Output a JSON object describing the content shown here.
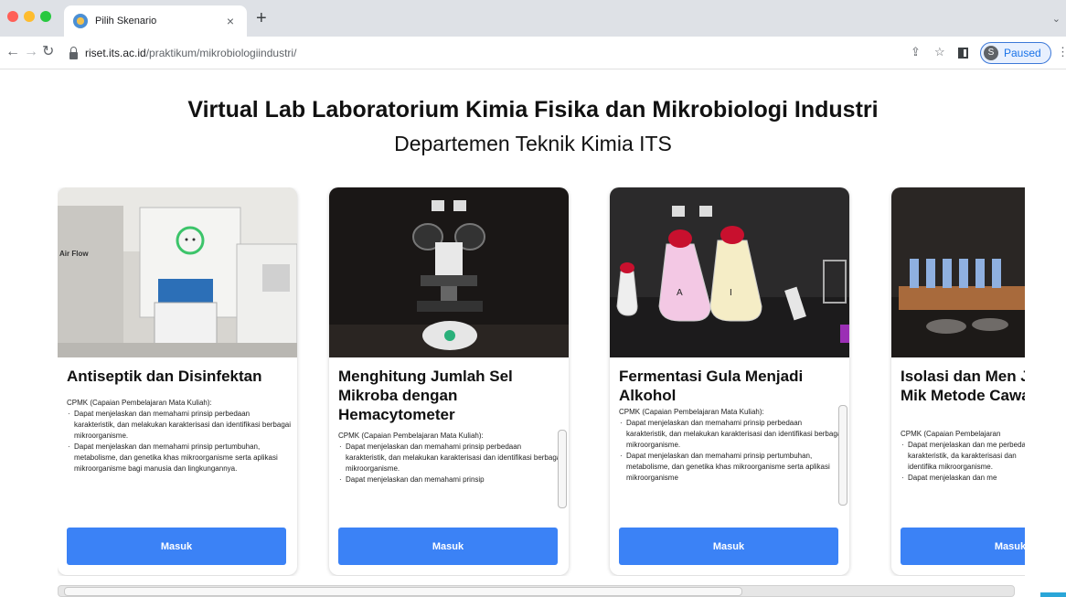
{
  "browser": {
    "tab_title": "Pilih Skenario",
    "tab_close": "×",
    "new_tab": "+",
    "tab_menu": "⌄",
    "url_host": "riset.its.ac.id",
    "url_path": "/praktikum/mikrobiologiindustri/",
    "profile_initial": "S",
    "profile_label": "Paused"
  },
  "page": {
    "heading": "Virtual Lab Laboratorium Kimia Fisika dan Mikrobiologi Industri",
    "subheading": "Departemen Teknik Kimia ITS"
  },
  "cards": [
    {
      "title": "Antiseptik dan Disinfektan",
      "cpmk": "CPMK (Capaian Pembelajaran Mata Kuliah):",
      "points": [
        "Dapat menjelaskan dan memahami prinsip perbedaan karakteristik, dan melakukan karakterisasi dan identifikasi berbagai mikroorganisme.",
        "Dapat menjelaskan dan memahami prinsip pertumbuhan, metabolisme, dan genetika khas mikroorganisme serta aplikasi mikroorganisme bagi manusia dan lingkungannya."
      ],
      "button": "Masuk",
      "image_label": "Air Flow"
    },
    {
      "title": "Menghitung Jumlah Sel Mikroba dengan Hemacytometer",
      "cpmk": "CPMK (Capaian Pembelajaran Mata Kuliah):",
      "points": [
        "Dapat menjelaskan dan memahami prinsip perbedaan karakteristik, dan melakukan karakterisasi dan identifikasi berbagai mikroorganisme.",
        "Dapat menjelaskan dan memahami prinsip"
      ],
      "button": "Masuk"
    },
    {
      "title": "Fermentasi Gula Menjadi Alkohol",
      "cpmk": "CPMK (Capaian Pembelajaran Mata Kuliah):",
      "points": [
        "Dapat menjelaskan dan memahami prinsip perbedaan karakteristik, dan melakukan karakterisasi dan identifikasi berbagai mikroorganisme.",
        "Dapat menjelaskan dan memahami prinsip pertumbuhan, metabolisme, dan genetika khas mikroorganisme serta aplikasi mikroorganisme"
      ],
      "button": "Masuk",
      "flask_a": "A",
      "flask_b": "I"
    },
    {
      "title": "Isolasi dan Men Jumlah Sel Mik Metode Cawan",
      "cpmk": "CPMK (Capaian Pembelajaran",
      "points": [
        "Dapat menjelaskan dan me perbedaan karakteristik, da karakterisasi dan identifika mikroorganisme.",
        "Dapat menjelaskan dan me"
      ],
      "button": "Masuk"
    }
  ]
}
